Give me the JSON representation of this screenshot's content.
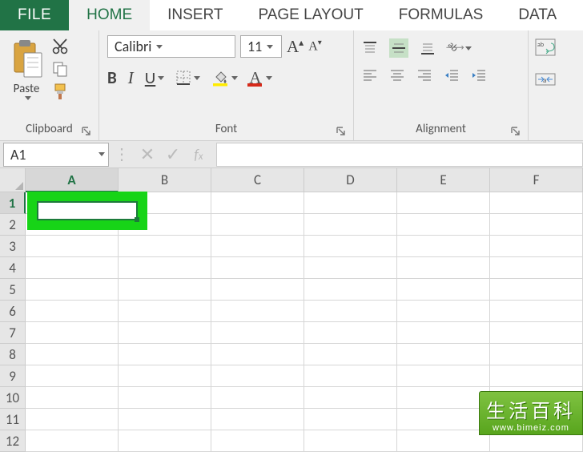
{
  "menu": {
    "file": "FILE",
    "tabs": [
      "HOME",
      "INSERT",
      "PAGE LAYOUT",
      "FORMULAS",
      "DATA"
    ],
    "active_tab": "HOME"
  },
  "ribbon": {
    "clipboard": {
      "label": "Clipboard",
      "paste": "Paste"
    },
    "font": {
      "label": "Font",
      "family": "Calibri",
      "size": "11",
      "bold": "B",
      "italic": "I",
      "underline": "U"
    },
    "alignment": {
      "label": "Alignment"
    }
  },
  "name_box": "A1",
  "formula_bar_value": "",
  "columns": [
    "A",
    "B",
    "C",
    "D",
    "E",
    "F"
  ],
  "rows": [
    "1",
    "2",
    "3",
    "4",
    "5",
    "6",
    "7",
    "8",
    "9",
    "10",
    "11",
    "12"
  ],
  "active_cell": {
    "row": 0,
    "col": 0,
    "ref": "A1"
  },
  "watermark": {
    "title": "生活百科",
    "url": "www.bimeiz.com"
  }
}
